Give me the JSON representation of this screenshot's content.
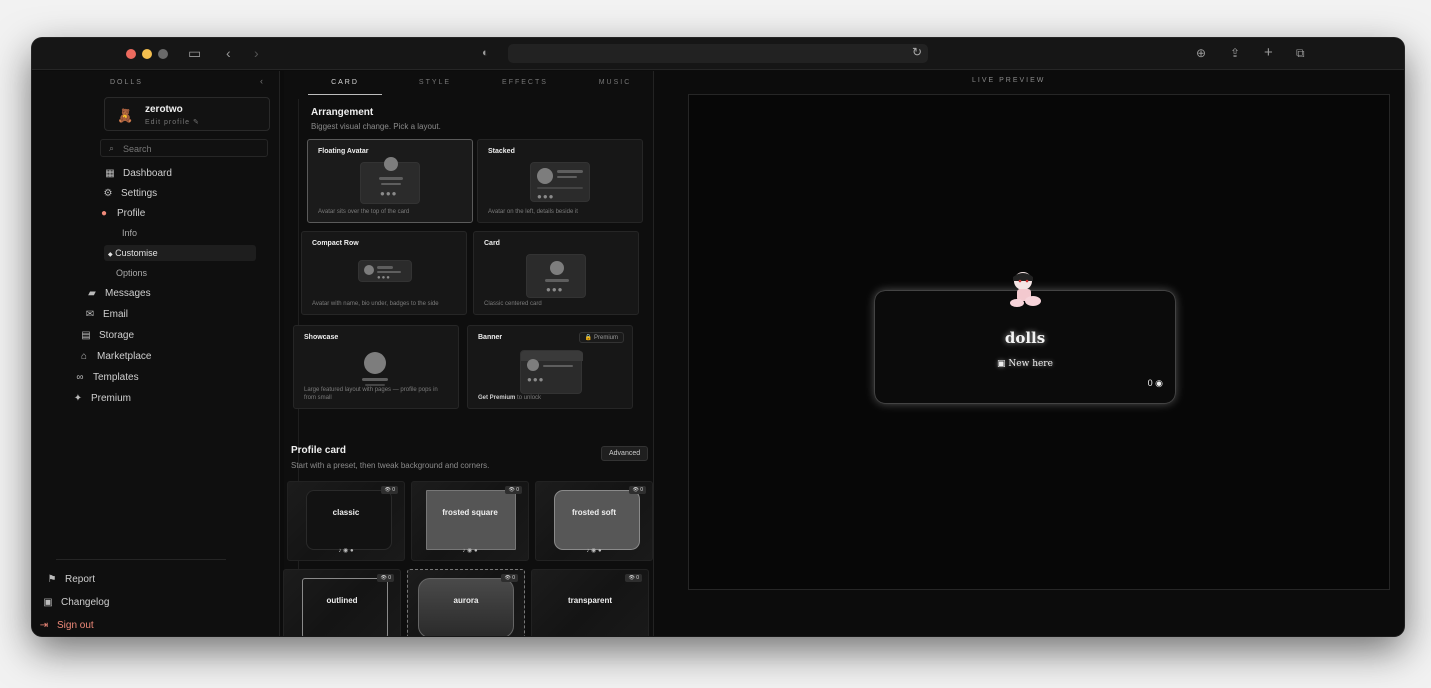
{
  "browser": {
    "url": ""
  },
  "sidebar": {
    "brand": "DOLLS",
    "user": {
      "name": "zerotwo",
      "edit_label": "Edit profile ✎"
    },
    "search_placeholder": "Search",
    "items": [
      {
        "label": "Dashboard",
        "icon": "dashboard-icon"
      },
      {
        "label": "Settings",
        "icon": "gear-icon"
      },
      {
        "label": "Profile",
        "icon": "user-icon"
      },
      {
        "label": "Info"
      },
      {
        "label": "Customise",
        "active": true
      },
      {
        "label": "Options"
      },
      {
        "label": "Messages",
        "icon": "chat-icon"
      },
      {
        "label": "Email",
        "icon": "mail-icon"
      },
      {
        "label": "Storage",
        "icon": "storage-icon"
      },
      {
        "label": "Marketplace",
        "icon": "store-icon"
      },
      {
        "label": "Templates",
        "icon": "templates-icon"
      },
      {
        "label": "Premium",
        "icon": "sparkle-icon"
      }
    ],
    "footer": [
      {
        "label": "Report",
        "icon": "flag-icon"
      },
      {
        "label": "Changelog",
        "icon": "scroll-icon"
      },
      {
        "label": "Sign out",
        "icon": "signout-icon",
        "color": "#f08a7a"
      }
    ]
  },
  "tabs": [
    "CARD",
    "STYLE",
    "EFFECTS",
    "MUSIC"
  ],
  "arrangement": {
    "title": "Arrangement",
    "subtitle": "Biggest visual change. Pick a layout.",
    "options": [
      {
        "name": "Floating Avatar",
        "desc": "Avatar sits over the top of the card",
        "selected": true
      },
      {
        "name": "Stacked",
        "desc": "Avatar on the left, details beside it"
      },
      {
        "name": "Compact Row",
        "desc": "Avatar with name, bio under, badges to the side"
      },
      {
        "name": "Card",
        "desc": "Classic centered card"
      },
      {
        "name": "Showcase",
        "desc": "Large featured layout with pages — profile pops in from small"
      },
      {
        "name": "Banner",
        "badge": "🔒 Premium",
        "desc_strong": "Get Premium",
        "desc_rest": " to unlock"
      }
    ]
  },
  "profile_card": {
    "title": "Profile card",
    "subtitle": "Start with a preset, then tweak background and corners.",
    "advanced_label": "Advanced",
    "presets": [
      {
        "name": "classic",
        "views": "👁 0",
        "icons": "♪ ◉ ●"
      },
      {
        "name": "frosted square",
        "views": "👁 0",
        "icons": "♪ ◉ ●"
      },
      {
        "name": "frosted soft",
        "views": "👁 0",
        "icons": "♪ ◉ ●"
      },
      {
        "name": "outlined",
        "views": "👁 0",
        "icons": "♪ ◉ ●"
      },
      {
        "name": "aurora",
        "views": "👁 0",
        "icons": "♪ ◉ ●"
      },
      {
        "name": "transparent",
        "views": "👁 0",
        "icons": "♪ ◉ ●"
      }
    ]
  },
  "preview": {
    "label": "LIVE PREVIEW",
    "name": "dolls",
    "badge": "New here",
    "views": "0"
  }
}
